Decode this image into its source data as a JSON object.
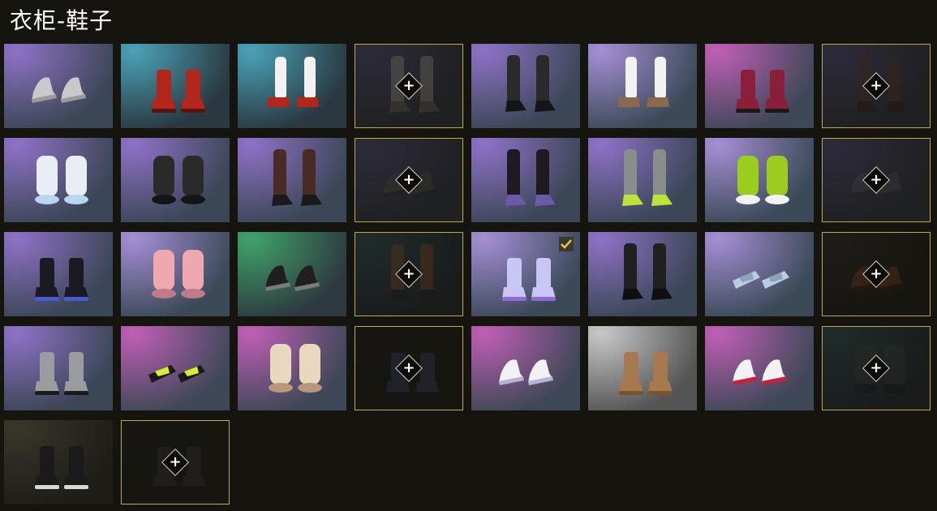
{
  "header": {
    "title": "衣柜-鞋子"
  },
  "icons": {
    "plus": "+",
    "unlock_icon": "plus-diamond-icon",
    "equipped_icon": "check-icon"
  },
  "colors": {
    "locked_border": "#bfa94a",
    "equipped_check": "#e8d23c"
  },
  "items": [
    {
      "name": "winged-silver-shoes",
      "locked": false,
      "equipped": false,
      "bg": [
        "#8f72c8",
        "#3b4656"
      ],
      "style": "sneaker",
      "c1": "#c9c9c9",
      "c2": "#9a9a9a"
    },
    {
      "name": "red-boots",
      "locked": false,
      "equipped": false,
      "bg": [
        "#4aa3b8",
        "#2a3840"
      ],
      "style": "boot",
      "c1": "#b3261b",
      "c2": "#5a1410"
    },
    {
      "name": "white-socks-red-heels",
      "locked": false,
      "equipped": false,
      "bg": [
        "#4aa3b8",
        "#2a3840"
      ],
      "style": "sock",
      "c1": "#f2f2f2",
      "c2": "#b3261b"
    },
    {
      "name": "grey-knee-boots",
      "locked": true,
      "equipped": false,
      "bg": [
        "#2d2b3a",
        "#1f2022"
      ],
      "style": "tall",
      "c1": "#6a6658",
      "c2": "#4a4438"
    },
    {
      "name": "black-knee-boots",
      "locked": false,
      "equipped": false,
      "bg": [
        "#8f72c8",
        "#3b4656"
      ],
      "style": "tall",
      "c1": "#2a2a2a",
      "c2": "#151515"
    },
    {
      "name": "white-socks-loafers",
      "locked": false,
      "equipped": false,
      "bg": [
        "#a58fd6",
        "#3c4a58"
      ],
      "style": "sock",
      "c1": "#f2f2f2",
      "c2": "#8a6a4a"
    },
    {
      "name": "striped-platform-boots",
      "locked": false,
      "equipped": false,
      "bg": [
        "#c05fb6",
        "#3f4858"
      ],
      "style": "boot",
      "c1": "#8a1f3a",
      "c2": "#1a1a1a"
    },
    {
      "name": "brown-tall-boots",
      "locked": true,
      "equipped": false,
      "bg": [
        "#2d2b3a",
        "#1f2022"
      ],
      "style": "tall",
      "c1": "#3a2418",
      "c2": "#23150e"
    },
    {
      "name": "white-fluffy-boots",
      "locked": false,
      "equipped": false,
      "bg": [
        "#8f72c8",
        "#3b4656"
      ],
      "style": "fluffy",
      "c1": "#e9eef5",
      "c2": "#b8d6f0"
    },
    {
      "name": "black-fluffy-boots",
      "locked": false,
      "equipped": false,
      "bg": [
        "#8f72c8",
        "#3b4656"
      ],
      "style": "fluffy",
      "c1": "#2a2a2a",
      "c2": "#151515"
    },
    {
      "name": "laced-thigh-boots",
      "locked": false,
      "equipped": false,
      "bg": [
        "#8f72c8",
        "#3b4656"
      ],
      "style": "tall",
      "c1": "#4a2a24",
      "c2": "#1a1a1a"
    },
    {
      "name": "dark-sneakers-locked",
      "locked": true,
      "equipped": false,
      "bg": [
        "#2d2b3a",
        "#1f2022"
      ],
      "style": "sneaker",
      "c1": "#2f3a2a",
      "c2": "#1a2018"
    },
    {
      "name": "black-purple-thigh-boots",
      "locked": false,
      "equipped": false,
      "bg": [
        "#8f72c8",
        "#3b4656"
      ],
      "style": "tall",
      "c1": "#1f1a22",
      "c2": "#6a5aa8"
    },
    {
      "name": "silver-green-sneaker-boots",
      "locked": false,
      "equipped": false,
      "bg": [
        "#8f72c8",
        "#3b4656"
      ],
      "style": "tall",
      "c1": "#8a8e8a",
      "c2": "#bde23a"
    },
    {
      "name": "lime-leg-warmers",
      "locked": false,
      "equipped": false,
      "bg": [
        "#a58fd6",
        "#3c4a58"
      ],
      "style": "fluffy",
      "c1": "#9acd1e",
      "c2": "#f2f2f2"
    },
    {
      "name": "dark-shoes-locked",
      "locked": true,
      "equipped": false,
      "bg": [
        "#2d2b3a",
        "#1f2022"
      ],
      "style": "sneaker",
      "c1": "#3a3a3a",
      "c2": "#222222"
    },
    {
      "name": "black-blue-boots",
      "locked": false,
      "equipped": false,
      "bg": [
        "#8f72c8",
        "#3b4656"
      ],
      "style": "boot",
      "c1": "#1a1a22",
      "c2": "#4a5ad0"
    },
    {
      "name": "pink-puffy-boots",
      "locked": false,
      "equipped": false,
      "bg": [
        "#a58fd6",
        "#3c4a58"
      ],
      "style": "fluffy",
      "c1": "#f0a8b0",
      "c2": "#c07a8a"
    },
    {
      "name": "black-studded-shoes",
      "locked": false,
      "equipped": false,
      "bg": [
        "#3fa36a",
        "#2e3a40"
      ],
      "style": "sneaker",
      "c1": "#1f1f1f",
      "c2": "#7a7a7a"
    },
    {
      "name": "brown-pants-boots-locked",
      "locked": true,
      "equipped": false,
      "bg": [
        "#1f2b2a",
        "#1a1c1c"
      ],
      "style": "tall",
      "c1": "#5a3418",
      "c2": "#1a1a1a"
    },
    {
      "name": "lavender-platform-boots",
      "locked": false,
      "equipped": true,
      "bg": [
        "#a58fd6",
        "#3c4a58"
      ],
      "style": "boot",
      "c1": "#c8c6f5",
      "c2": "#8f6ad6"
    },
    {
      "name": "black-jeans-boots",
      "locked": false,
      "equipped": false,
      "bg": [
        "#8f72c8",
        "#3b4656"
      ],
      "style": "tall",
      "c1": "#202020",
      "c2": "#0f0f0f"
    },
    {
      "name": "pale-blue-slides",
      "locked": false,
      "equipped": false,
      "bg": [
        "#a58fd6",
        "#3c4a58"
      ],
      "style": "slide",
      "c1": "#b9cce0",
      "c2": "#8aa4be"
    },
    {
      "name": "brown-shoes-locked",
      "locked": true,
      "equipped": false,
      "bg": [
        "#1d1c18",
        "#16150f"
      ],
      "style": "sneaker",
      "c1": "#5a2e1e",
      "c2": "#2a1810"
    },
    {
      "name": "grey-combat-boots",
      "locked": false,
      "equipped": false,
      "bg": [
        "#8f72c8",
        "#3b4656"
      ],
      "style": "boot",
      "c1": "#9a9ca0",
      "c2": "#1a1a1a"
    },
    {
      "name": "neon-flats",
      "locked": false,
      "equipped": false,
      "bg": [
        "#c05fb6",
        "#3f4858"
      ],
      "style": "slide",
      "c1": "#1a1a1a",
      "c2": "#d7ef2a"
    },
    {
      "name": "beige-fur-boots",
      "locked": false,
      "equipped": false,
      "bg": [
        "#c05fb6",
        "#3f4858"
      ],
      "style": "fluffy",
      "c1": "#e8d8c0",
      "c2": "#b89878"
    },
    {
      "name": "navy-boots-locked",
      "locked": true,
      "equipped": false,
      "bg": [
        "#171613",
        "#16150f"
      ],
      "style": "boot",
      "c1": "#2a3448",
      "c2": "#141822"
    },
    {
      "name": "white-purple-sneakers",
      "locked": false,
      "equipped": false,
      "bg": [
        "#c05fb6",
        "#3f4858"
      ],
      "style": "sneaker",
      "c1": "#f2f2f2",
      "c2": "#b8b0d8"
    },
    {
      "name": "tan-work-boots",
      "locked": false,
      "equipped": false,
      "bg": [
        "#c8c8c8",
        "#555555"
      ],
      "style": "boot",
      "c1": "#a67a4e",
      "c2": "#7a5232"
    },
    {
      "name": "white-red-sneakers",
      "locked": false,
      "equipped": false,
      "bg": [
        "#c05fb6",
        "#3f4858"
      ],
      "style": "sneaker",
      "c1": "#f2f2f2",
      "c2": "#c8203a"
    },
    {
      "name": "black-fur-boots-locked",
      "locked": true,
      "equipped": false,
      "bg": [
        "#1f2b2a",
        "#1a1c1c"
      ],
      "style": "fluffy",
      "c1": "#2a2a2a",
      "c2": "#151515"
    },
    {
      "name": "black-fur-trim-boots",
      "locked": false,
      "equipped": false,
      "bg": [
        "#3a362a",
        "#1e1d18"
      ],
      "style": "boot",
      "c1": "#1a1a1a",
      "c2": "#d8d8d8"
    },
    {
      "name": "black-boots-locked",
      "locked": true,
      "equipped": false,
      "bg": [
        "#171613",
        "#16150f"
      ],
      "style": "boot",
      "c1": "#2a2a2a",
      "c2": "#151515"
    }
  ]
}
